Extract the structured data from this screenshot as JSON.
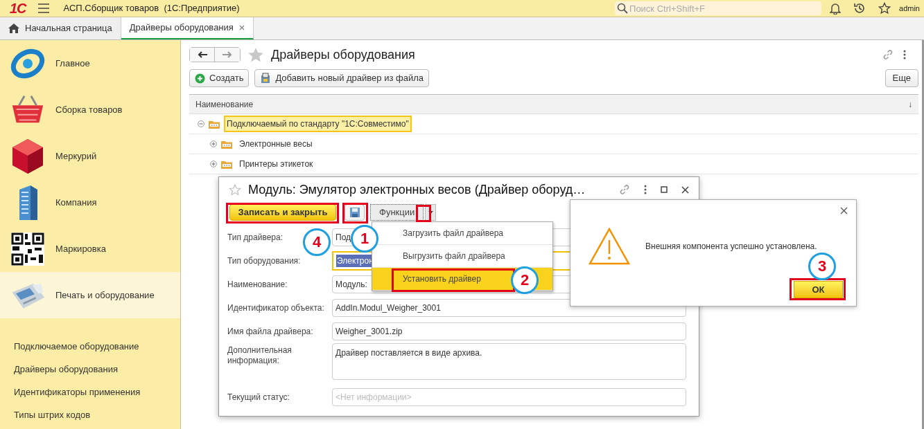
{
  "app_bar": {
    "logo": "1С",
    "title": "АСП.Сборщик товаров  (1С:Предприятие)",
    "search": {
      "placeholder": "Поиск Ctrl+Shift+F"
    },
    "user": "admin"
  },
  "tabs": [
    {
      "label": "Начальная страница",
      "selected": false,
      "kind": "home"
    },
    {
      "label": "Драйверы оборудования",
      "selected": true,
      "kind": "closable"
    }
  ],
  "sidebar": {
    "sections": [
      {
        "label": "Главное",
        "selected": false
      },
      {
        "label": "Сборка товаров",
        "selected": false
      },
      {
        "label": "Меркурий",
        "selected": false
      },
      {
        "label": "Компания",
        "selected": false
      },
      {
        "label": "Маркировка",
        "selected": false
      },
      {
        "label": "Печать и оборудование",
        "selected": true
      }
    ],
    "links": [
      "Подключаемое оборудование",
      "Драйверы оборудования",
      "Идентификаторы применения",
      "Типы штрих кодов"
    ]
  },
  "page": {
    "title": "Драйверы оборудования",
    "buttons": [
      {
        "label": "Создать",
        "kind": "create"
      },
      {
        "label": "Добавить новый драйвер из файла",
        "kind": "file"
      }
    ],
    "more_button": "Еще",
    "table": {
      "columns": [
        "Наименование"
      ],
      "sort_mark": "↓",
      "rows": [
        {
          "name": "Подключаемый по стандарту \"1С:Совместимо\"",
          "selected": true,
          "expanded": true,
          "children": [
            {
              "name": "Электронные весы",
              "selected": false,
              "expanded": false
            },
            {
              "name": "Принтеры этикеток",
              "selected": false,
              "expanded": false
            }
          ]
        }
      ]
    }
  },
  "dialog": {
    "title": "Модуль: Эмулятор электронных весов (Драйвер оборуд…",
    "save_close_button": "Записать и закрыть",
    "functions_button": "Функции",
    "fields": [
      {
        "label": "Тип драйвера:",
        "value": "Под",
        "kind": "input"
      },
      {
        "label": "Тип оборудования:",
        "value": "Электрон",
        "kind": "focused"
      },
      {
        "label": "Наименование:",
        "value": "Модуль:",
        "kind": "input"
      },
      {
        "label": "Идентификатор объекта:",
        "value": "AddIn.Modul_Weigher_3001",
        "kind": "input"
      },
      {
        "label": "Имя файла драйвера:",
        "value": "Weigher_3001.zip",
        "kind": "input"
      },
      {
        "label": "Дополнительная информация:",
        "value": "Драйвер поставляется в виде архива.",
        "kind": "textarea"
      },
      {
        "label": "Текущий статус:",
        "placeholder": "<Нет информации>",
        "kind": "input"
      }
    ],
    "menu": [
      {
        "label": "Загрузить файл драйвера",
        "selected": false
      },
      {
        "label": "Выгрузить файл драйвера",
        "selected": false
      },
      {
        "label": "Установить драйвер",
        "selected": true
      }
    ]
  },
  "message_box": {
    "text": "Внешняя компонента успешно установлена.",
    "ok_button": "ОК"
  },
  "annotations": [
    {
      "number": "1"
    },
    {
      "number": "2"
    },
    {
      "number": "3"
    },
    {
      "number": "4"
    }
  ]
}
